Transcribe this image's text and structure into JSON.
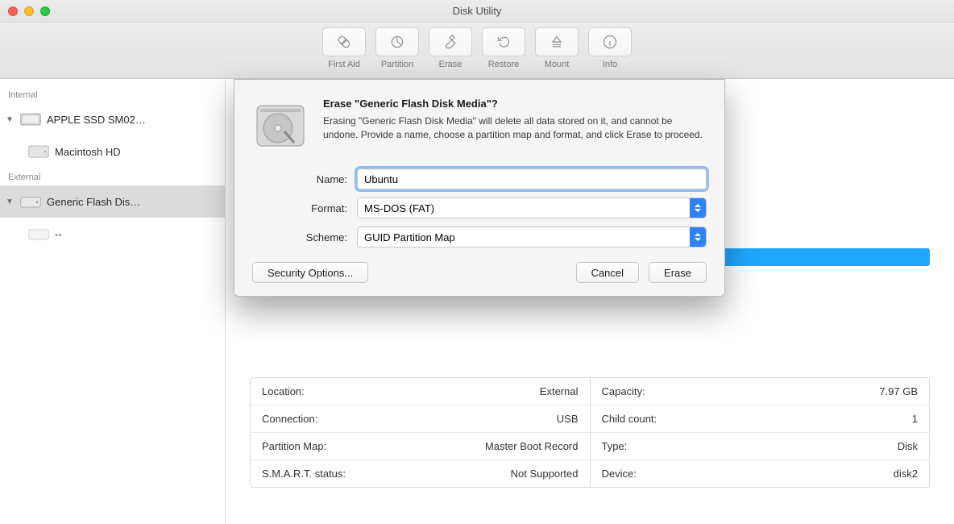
{
  "window": {
    "title": "Disk Utility"
  },
  "toolbar": {
    "items": [
      {
        "label": "First Aid"
      },
      {
        "label": "Partition"
      },
      {
        "label": "Erase"
      },
      {
        "label": "Restore"
      },
      {
        "label": "Mount"
      },
      {
        "label": "Info"
      }
    ]
  },
  "sidebar": {
    "sections": [
      {
        "title": "Internal",
        "items": [
          {
            "label": "APPLE SSD SM02…",
            "children": [
              {
                "label": "Macintosh HD"
              }
            ]
          }
        ]
      },
      {
        "title": "External",
        "items": [
          {
            "label": "Generic Flash Dis…",
            "selected": true,
            "children": [
              {
                "label": "--"
              }
            ]
          }
        ]
      }
    ]
  },
  "details": {
    "left": [
      {
        "key": "Location:",
        "value": "External"
      },
      {
        "key": "Connection:",
        "value": "USB"
      },
      {
        "key": "Partition Map:",
        "value": "Master Boot Record"
      },
      {
        "key": "S.M.A.R.T. status:",
        "value": "Not Supported"
      }
    ],
    "right": [
      {
        "key": "Capacity:",
        "value": "7.97 GB"
      },
      {
        "key": "Child count:",
        "value": "1"
      },
      {
        "key": "Type:",
        "value": "Disk"
      },
      {
        "key": "Device:",
        "value": "disk2"
      }
    ]
  },
  "dialog": {
    "heading": "Erase \"Generic Flash Disk Media\"?",
    "description": "Erasing \"Generic Flash Disk Media\" will delete all data stored on it, and cannot be undone. Provide a name, choose a partition map and format, and click Erase to proceed.",
    "labels": {
      "name": "Name:",
      "format": "Format:",
      "scheme": "Scheme:"
    },
    "values": {
      "name": "Ubuntu",
      "format": "MS-DOS (FAT)",
      "scheme": "GUID Partition Map"
    },
    "buttons": {
      "security": "Security Options...",
      "cancel": "Cancel",
      "erase": "Erase"
    }
  }
}
